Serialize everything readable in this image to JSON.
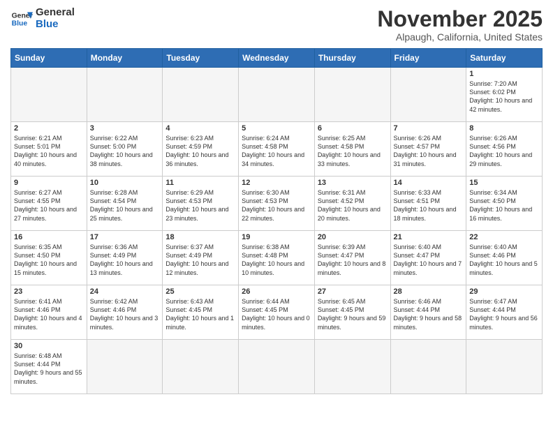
{
  "header": {
    "logo_general": "General",
    "logo_blue": "Blue",
    "month_title": "November 2025",
    "subtitle": "Alpaugh, California, United States"
  },
  "days_of_week": [
    "Sunday",
    "Monday",
    "Tuesday",
    "Wednesday",
    "Thursday",
    "Friday",
    "Saturday"
  ],
  "weeks": [
    [
      {
        "day": "",
        "info": ""
      },
      {
        "day": "",
        "info": ""
      },
      {
        "day": "",
        "info": ""
      },
      {
        "day": "",
        "info": ""
      },
      {
        "day": "",
        "info": ""
      },
      {
        "day": "",
        "info": ""
      },
      {
        "day": "1",
        "info": "Sunrise: 7:20 AM\nSunset: 6:02 PM\nDaylight: 10 hours and 42 minutes."
      }
    ],
    [
      {
        "day": "2",
        "info": "Sunrise: 6:21 AM\nSunset: 5:01 PM\nDaylight: 10 hours and 40 minutes."
      },
      {
        "day": "3",
        "info": "Sunrise: 6:22 AM\nSunset: 5:00 PM\nDaylight: 10 hours and 38 minutes."
      },
      {
        "day": "4",
        "info": "Sunrise: 6:23 AM\nSunset: 4:59 PM\nDaylight: 10 hours and 36 minutes."
      },
      {
        "day": "5",
        "info": "Sunrise: 6:24 AM\nSunset: 4:58 PM\nDaylight: 10 hours and 34 minutes."
      },
      {
        "day": "6",
        "info": "Sunrise: 6:25 AM\nSunset: 4:58 PM\nDaylight: 10 hours and 33 minutes."
      },
      {
        "day": "7",
        "info": "Sunrise: 6:26 AM\nSunset: 4:57 PM\nDaylight: 10 hours and 31 minutes."
      },
      {
        "day": "8",
        "info": "Sunrise: 6:26 AM\nSunset: 4:56 PM\nDaylight: 10 hours and 29 minutes."
      }
    ],
    [
      {
        "day": "9",
        "info": "Sunrise: 6:27 AM\nSunset: 4:55 PM\nDaylight: 10 hours and 27 minutes."
      },
      {
        "day": "10",
        "info": "Sunrise: 6:28 AM\nSunset: 4:54 PM\nDaylight: 10 hours and 25 minutes."
      },
      {
        "day": "11",
        "info": "Sunrise: 6:29 AM\nSunset: 4:53 PM\nDaylight: 10 hours and 23 minutes."
      },
      {
        "day": "12",
        "info": "Sunrise: 6:30 AM\nSunset: 4:53 PM\nDaylight: 10 hours and 22 minutes."
      },
      {
        "day": "13",
        "info": "Sunrise: 6:31 AM\nSunset: 4:52 PM\nDaylight: 10 hours and 20 minutes."
      },
      {
        "day": "14",
        "info": "Sunrise: 6:33 AM\nSunset: 4:51 PM\nDaylight: 10 hours and 18 minutes."
      },
      {
        "day": "15",
        "info": "Sunrise: 6:34 AM\nSunset: 4:50 PM\nDaylight: 10 hours and 16 minutes."
      }
    ],
    [
      {
        "day": "16",
        "info": "Sunrise: 6:35 AM\nSunset: 4:50 PM\nDaylight: 10 hours and 15 minutes."
      },
      {
        "day": "17",
        "info": "Sunrise: 6:36 AM\nSunset: 4:49 PM\nDaylight: 10 hours and 13 minutes."
      },
      {
        "day": "18",
        "info": "Sunrise: 6:37 AM\nSunset: 4:49 PM\nDaylight: 10 hours and 12 minutes."
      },
      {
        "day": "19",
        "info": "Sunrise: 6:38 AM\nSunset: 4:48 PM\nDaylight: 10 hours and 10 minutes."
      },
      {
        "day": "20",
        "info": "Sunrise: 6:39 AM\nSunset: 4:47 PM\nDaylight: 10 hours and 8 minutes."
      },
      {
        "day": "21",
        "info": "Sunrise: 6:40 AM\nSunset: 4:47 PM\nDaylight: 10 hours and 7 minutes."
      },
      {
        "day": "22",
        "info": "Sunrise: 6:40 AM\nSunset: 4:46 PM\nDaylight: 10 hours and 5 minutes."
      }
    ],
    [
      {
        "day": "23",
        "info": "Sunrise: 6:41 AM\nSunset: 4:46 PM\nDaylight: 10 hours and 4 minutes."
      },
      {
        "day": "24",
        "info": "Sunrise: 6:42 AM\nSunset: 4:46 PM\nDaylight: 10 hours and 3 minutes."
      },
      {
        "day": "25",
        "info": "Sunrise: 6:43 AM\nSunset: 4:45 PM\nDaylight: 10 hours and 1 minute."
      },
      {
        "day": "26",
        "info": "Sunrise: 6:44 AM\nSunset: 4:45 PM\nDaylight: 10 hours and 0 minutes."
      },
      {
        "day": "27",
        "info": "Sunrise: 6:45 AM\nSunset: 4:45 PM\nDaylight: 9 hours and 59 minutes."
      },
      {
        "day": "28",
        "info": "Sunrise: 6:46 AM\nSunset: 4:44 PM\nDaylight: 9 hours and 58 minutes."
      },
      {
        "day": "29",
        "info": "Sunrise: 6:47 AM\nSunset: 4:44 PM\nDaylight: 9 hours and 56 minutes."
      }
    ],
    [
      {
        "day": "30",
        "info": "Sunrise: 6:48 AM\nSunset: 4:44 PM\nDaylight: 9 hours and 55 minutes."
      },
      {
        "day": "",
        "info": ""
      },
      {
        "day": "",
        "info": ""
      },
      {
        "day": "",
        "info": ""
      },
      {
        "day": "",
        "info": ""
      },
      {
        "day": "",
        "info": ""
      },
      {
        "day": "",
        "info": ""
      }
    ]
  ]
}
